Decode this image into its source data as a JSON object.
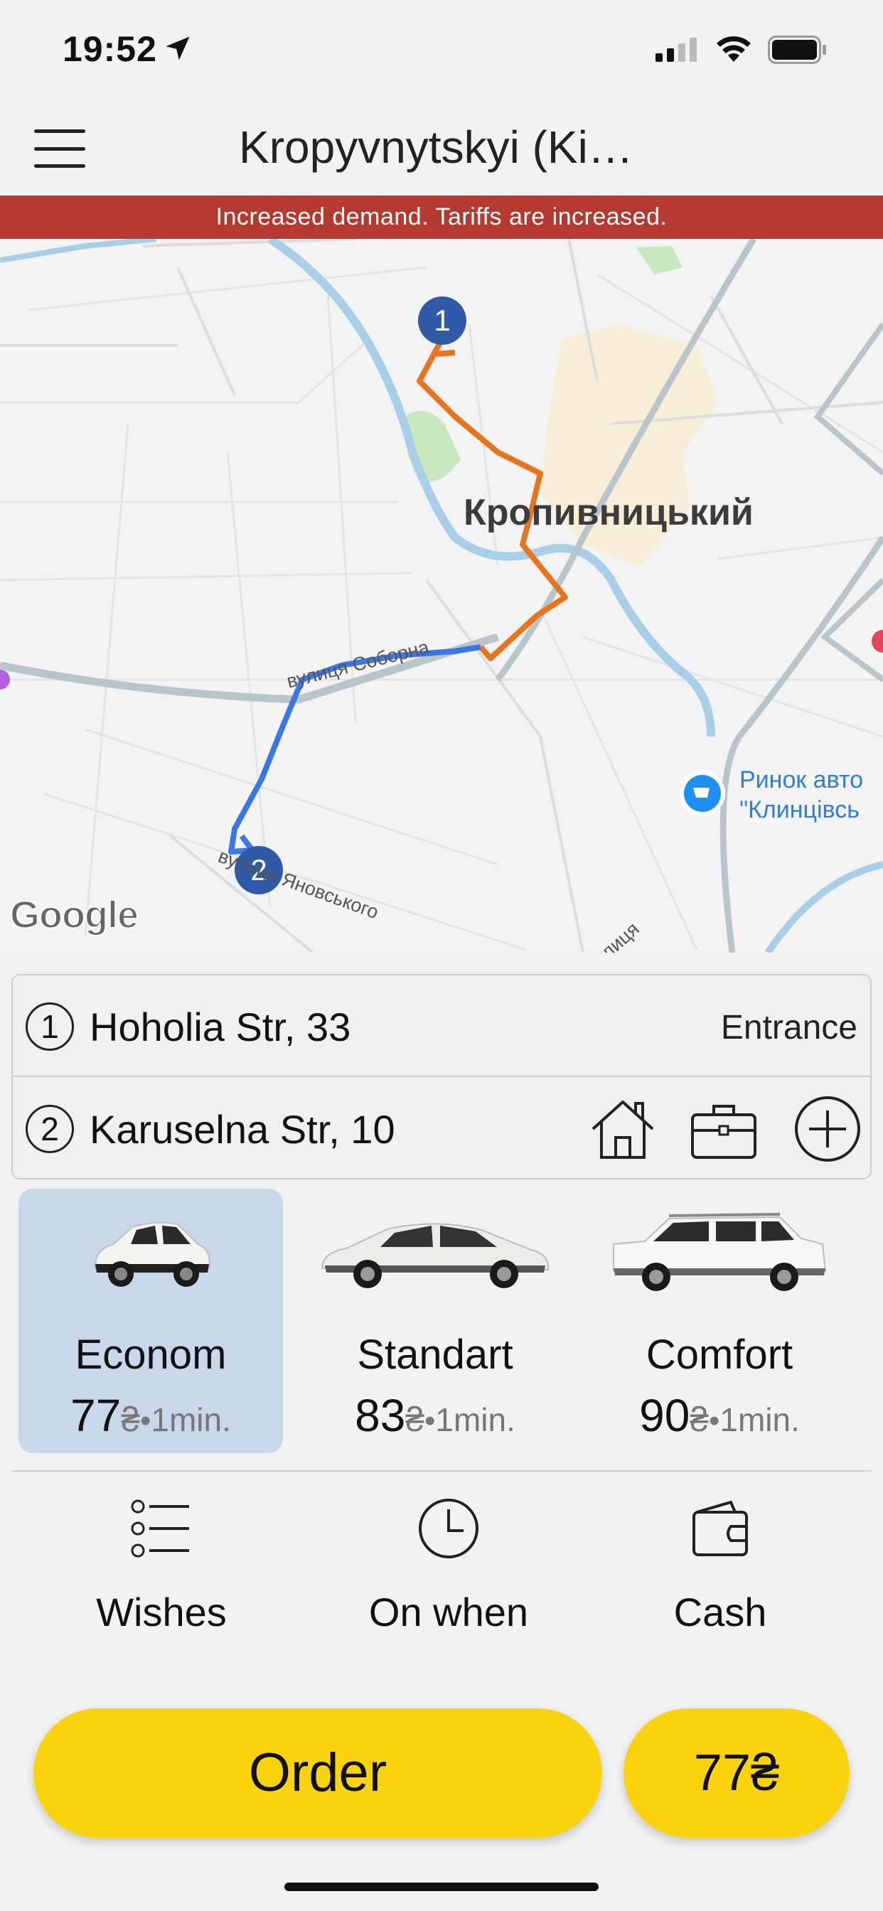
{
  "status_bar": {
    "time": "19:52"
  },
  "header": {
    "city_title": "Kropyvnytskyi (Ki…"
  },
  "banner": {
    "text": "Increased demand. Tariffs are increased."
  },
  "map": {
    "city_label": "Кропивницький",
    "streets": [
      "вулиця Соборна",
      "вулиця Яновського",
      "вулиця"
    ],
    "poi": {
      "line1": "Ринок авто",
      "line2": "\"Клинцівсь"
    },
    "markers": [
      "1",
      "2"
    ],
    "attribution": "Google"
  },
  "route": {
    "stops": [
      {
        "num": "1",
        "address": "Hoholia Str, 33",
        "extra": "Entrance"
      },
      {
        "num": "2",
        "address": "Karuselna Str, 10"
      }
    ],
    "icons": [
      "home-icon",
      "briefcase-icon",
      "add-stop-icon"
    ]
  },
  "tariffs": [
    {
      "name": "Econom",
      "price": "77",
      "currency": "₴",
      "eta": "1min.",
      "selected": true
    },
    {
      "name": "Standart",
      "price": "83",
      "currency": "₴",
      "eta": "1min.",
      "selected": false
    },
    {
      "name": "Comfort",
      "price": "90",
      "currency": "₴",
      "eta": "1min.",
      "selected": false
    }
  ],
  "options": [
    {
      "label": "Wishes",
      "icon": "list-icon"
    },
    {
      "label": "On when",
      "icon": "clock-icon"
    },
    {
      "label": "Cash",
      "icon": "wallet-icon"
    }
  ],
  "order": {
    "button_label": "Order",
    "price_label": "77₴"
  },
  "colors": {
    "accent": "#f8d30e",
    "banner": "#b43a2f",
    "selected_tariff": "#c8d7ea",
    "route_orange": "#e8741c",
    "route_blue": "#3b78e7"
  }
}
